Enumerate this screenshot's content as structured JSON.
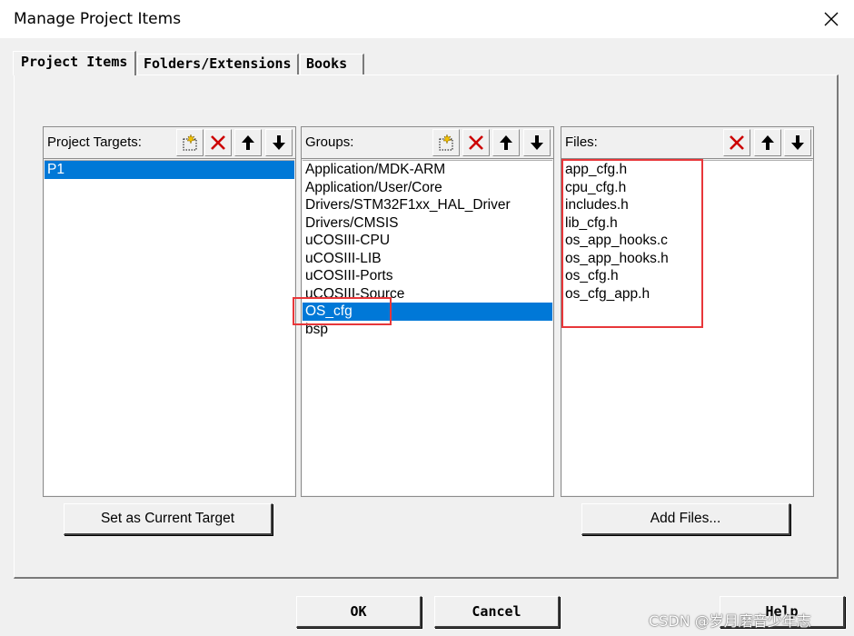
{
  "window": {
    "title": "Manage Project Items"
  },
  "tabs": [
    {
      "label": "Project Items"
    },
    {
      "label": "Folders/Extensions"
    },
    {
      "label": "Books"
    }
  ],
  "targets_panel": {
    "label": "Project Targets:",
    "items": [
      "P1"
    ],
    "selected": "P1"
  },
  "groups_panel": {
    "label": "Groups:",
    "items": [
      "Application/MDK-ARM",
      "Application/User/Core",
      "Drivers/STM32F1xx_HAL_Driver",
      "Drivers/CMSIS",
      "uCOSIII-CPU",
      "uCOSIII-LIB",
      "uCOSIII-Ports",
      "uCOSIII-Source",
      "OS_cfg",
      "bsp"
    ],
    "selected": "OS_cfg"
  },
  "files_panel": {
    "label": "Files:",
    "items": [
      "app_cfg.h",
      "cpu_cfg.h",
      "includes.h",
      "lib_cfg.h",
      "os_app_hooks.c",
      "os_app_hooks.h",
      "os_cfg.h",
      "os_cfg_app.h"
    ]
  },
  "buttons": {
    "set_current_target": "Set as Current Target",
    "add_files": "Add Files...",
    "ok": "OK",
    "cancel": "Cancel",
    "help": "Help"
  },
  "watermark": "CSDN @岁月磨音少年志",
  "colors": {
    "selection": "#0078d7",
    "highlight_box": "#e8373a",
    "delete_icon": "#cc0000"
  }
}
